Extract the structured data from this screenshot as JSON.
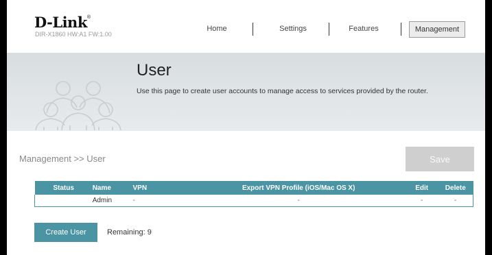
{
  "brand": {
    "logo": "D-Link",
    "mark": "®",
    "model": "DIR-X1860 HW:A1 FW:1.00"
  },
  "nav": [
    {
      "label": "Home"
    },
    {
      "label": "Settings"
    },
    {
      "label": "Features"
    },
    {
      "label": "Management",
      "active": true
    }
  ],
  "hero": {
    "title": "User",
    "description": "Use this page to create user accounts to manage access to services provided by the router."
  },
  "breadcrumb": "Management >> User",
  "save_label": "Save",
  "table": {
    "headers": [
      "Status",
      "Name",
      "VPN",
      "Export VPN Profile (iOS/Mac OS X)",
      "Edit",
      "Delete"
    ],
    "rows": [
      {
        "status": "",
        "name": "Admin",
        "vpn": "-",
        "export": "-",
        "edit": "-",
        "delete": "-"
      }
    ]
  },
  "create_user_label": "Create User",
  "remaining": "Remaining: 9",
  "colors": {
    "accent": "#4a94a3",
    "save_disabled": "#cfcfcf",
    "hero_bg": "#dde1e4"
  }
}
